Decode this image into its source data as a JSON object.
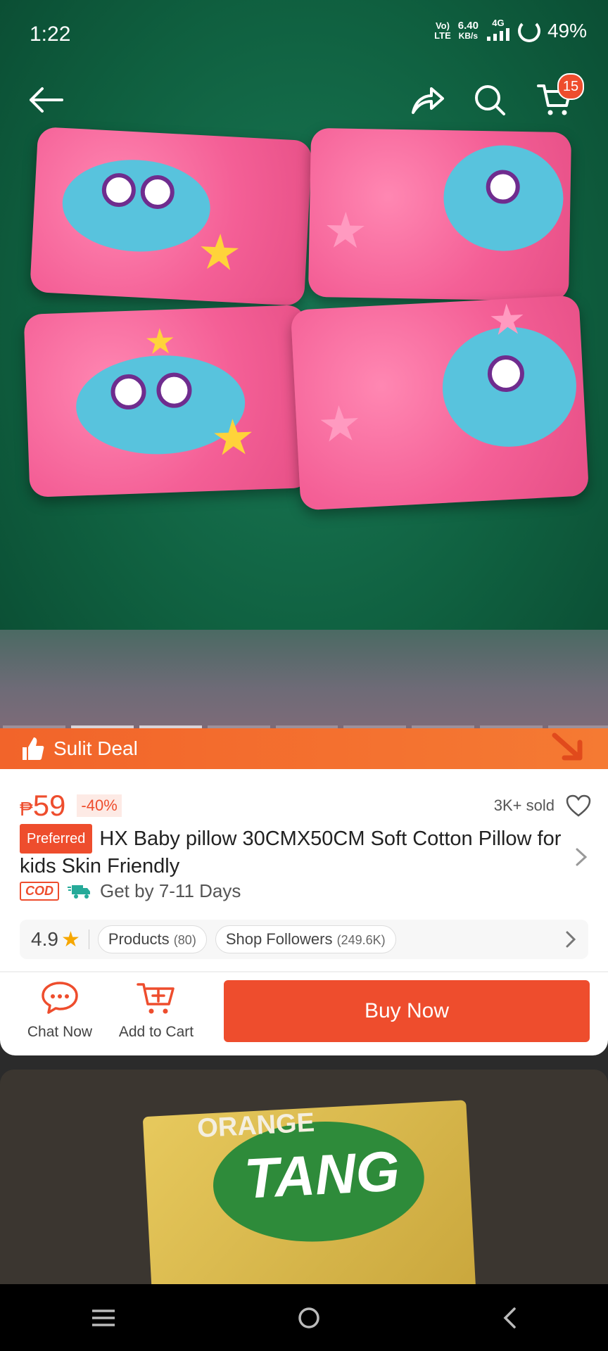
{
  "status_bar": {
    "time": "1:22",
    "network_top": "Vo)",
    "network_bottom": "LTE",
    "speed_value": "6.40",
    "speed_unit": "KB/s",
    "signal_label": "4G",
    "battery": "49%"
  },
  "header": {
    "cart_count": "15",
    "back_icon": "back-arrow-icon",
    "share_icon": "share-icon",
    "search_icon": "search-icon",
    "cart_icon": "cart-icon"
  },
  "deal": {
    "label": "Sulit Deal",
    "icon": "thumbs-up-icon"
  },
  "product": {
    "currency": "₱",
    "price": "59",
    "discount": "-40%",
    "sold": "3K+ sold",
    "preferred_label": "Preferred",
    "title": "HX Baby pillow  30CMX50CM Soft Cotton Pillow for kids Skin Friendly",
    "cod_label": "COD",
    "delivery_text": "Get by 7-11 Days"
  },
  "shop": {
    "rating": "4.9",
    "products_label": "Products",
    "products_count": "(80)",
    "followers_label": "Shop Followers",
    "followers_count": "(249.6K)"
  },
  "actions": {
    "chat_label": "Chat Now",
    "cart_label": "Add to Cart",
    "buy_label": "Buy Now"
  },
  "next_item": {
    "brand_top": "ORANGE",
    "brand": "TANG"
  },
  "colors": {
    "accent": "#ee4d2d",
    "deal_banner": "#f2642a"
  }
}
